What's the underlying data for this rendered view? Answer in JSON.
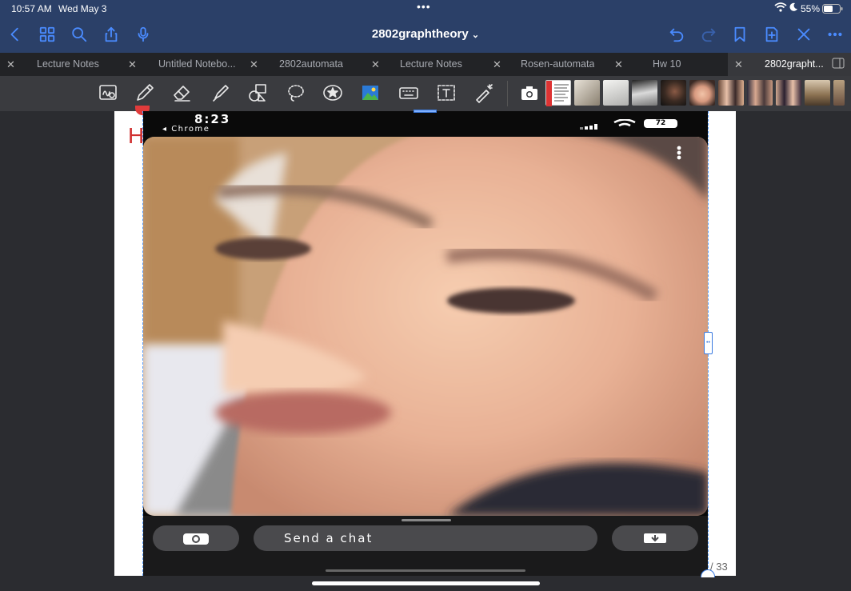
{
  "status": {
    "time": "10:57 AM",
    "date": "Wed May 3",
    "battery": "55%"
  },
  "nav": {
    "title": "2802graphtheory"
  },
  "tabs": [
    {
      "label": "Lecture Notes"
    },
    {
      "label": "Untitled Notebo..."
    },
    {
      "label": "2802automata"
    },
    {
      "label": "Lecture Notes"
    },
    {
      "label": "Rosen-automata"
    },
    {
      "label": "Hw 10"
    },
    {
      "label": "2802grapht..."
    }
  ],
  "icons": {
    "back": "chevron-left-icon",
    "grid": "grid-icon",
    "search": "search-icon",
    "share": "share-icon",
    "mic": "microphone-icon",
    "undo": "undo-icon",
    "redo": "redo-icon",
    "bookmark": "bookmark-icon",
    "add_page": "add-page-icon",
    "close": "close-icon",
    "more": "more-icon"
  },
  "colors": {
    "nav_bg": "#2b4068",
    "accent": "#4a8bff",
    "tabbar_bg": "#222326",
    "toolbar_bg": "#3a3b3f",
    "page_title_red": "#d03030"
  },
  "page": {
    "partial_title": "H",
    "page_number": "33"
  },
  "phone_screenshot": {
    "clock": "8:23",
    "back_app": "◂ Chrome",
    "battery": "72",
    "chat_placeholder": "Send a chat"
  }
}
